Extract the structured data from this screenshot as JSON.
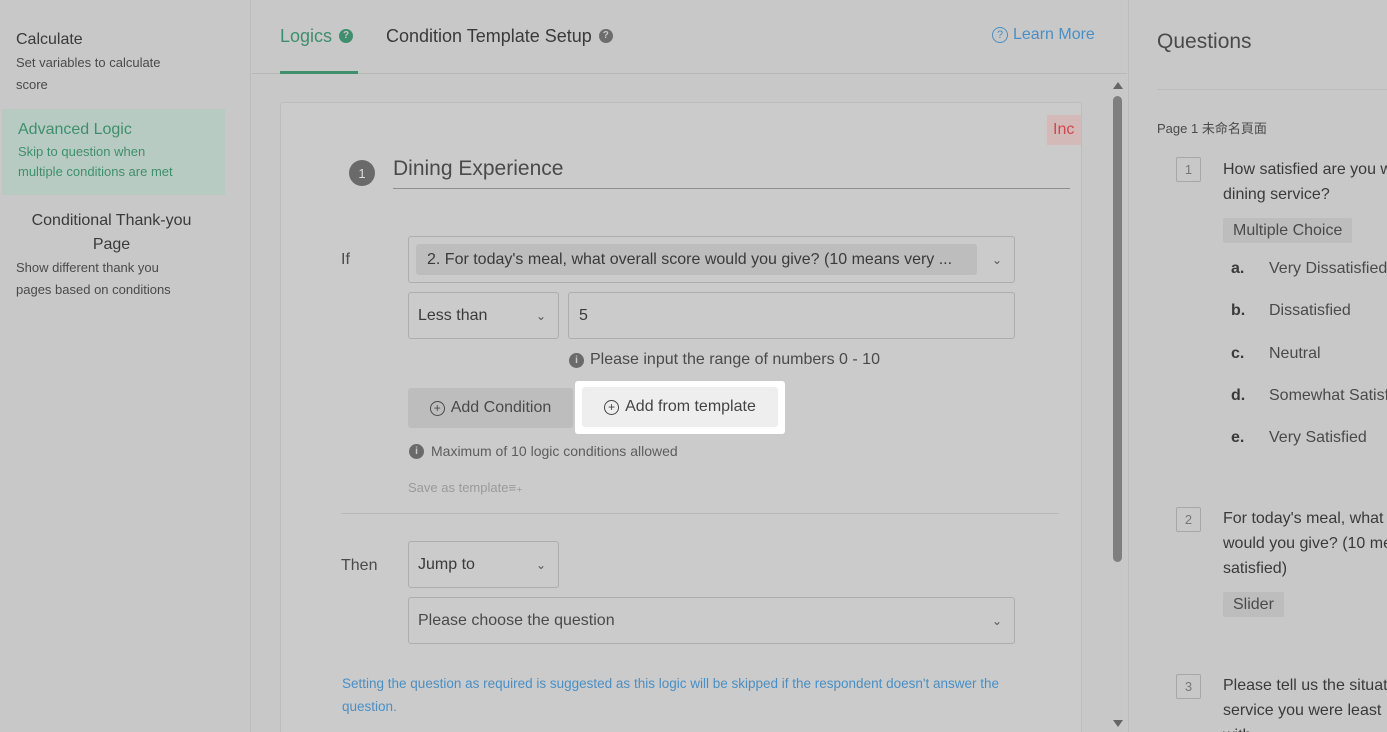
{
  "sidebar": {
    "items": [
      {
        "title": "Calculate",
        "desc_lines": [
          "Set variables to calculate",
          "score"
        ]
      },
      {
        "title": "Advanced Logic",
        "desc_lines": [
          "Skip to question when",
          "multiple conditions are met"
        ]
      },
      {
        "title_lines": [
          "Conditional Thank-you",
          "Page"
        ],
        "desc_lines": [
          "Show different thank you",
          "pages based on conditions"
        ]
      }
    ]
  },
  "tabs": {
    "logics": "Logics",
    "template_setup": "Condition Template Setup",
    "learn_more": "Learn More"
  },
  "rule": {
    "badge": "Inc",
    "number": "1",
    "title": "Dining Experience",
    "if_label": "If",
    "question_value": "2. For today's meal, what overall score would you give? (10 means very ...",
    "operator": "Less than",
    "value": "5",
    "range_hint": "Please input the range of numbers 0 - 10",
    "add_condition": "Add Condition",
    "add_from_template": "Add from template",
    "max_hint": "Maximum of 10 logic conditions allowed",
    "save_template": "Save as template",
    "then_label": "Then",
    "action": "Jump to",
    "target_placeholder": "Please choose the question",
    "note_lines": [
      "Setting the question as required is suggested as this logic will be skipped if the respondent doesn't answer the",
      "question."
    ]
  },
  "questions": {
    "title": "Questions",
    "page_label": "Page 1 未命名頁面",
    "list": [
      {
        "num": "1",
        "text_lines": [
          "How satisfied are you w",
          "dining service?"
        ],
        "type": "Multiple Choice",
        "options": [
          {
            "letter": "a.",
            "label": "Very Dissatisfied"
          },
          {
            "letter": "b.",
            "label": "Dissatisfied"
          },
          {
            "letter": "c.",
            "label": "Neutral"
          },
          {
            "letter": "d.",
            "label": "Somewhat Satisfied"
          },
          {
            "letter": "e.",
            "label": "Very Satisfied"
          }
        ]
      },
      {
        "num": "2",
        "text_lines": [
          "For today's meal, what o",
          "would you give? (10 me",
          "satisfied)"
        ],
        "type": "Slider"
      },
      {
        "num": "3",
        "text_lines": [
          "Please tell us the situat",
          "service you were least",
          "with"
        ]
      }
    ]
  },
  "colors": {
    "accent_green": "#3f8f6e",
    "link_blue": "#4a8fc4",
    "badge_red": "#d0474f"
  }
}
